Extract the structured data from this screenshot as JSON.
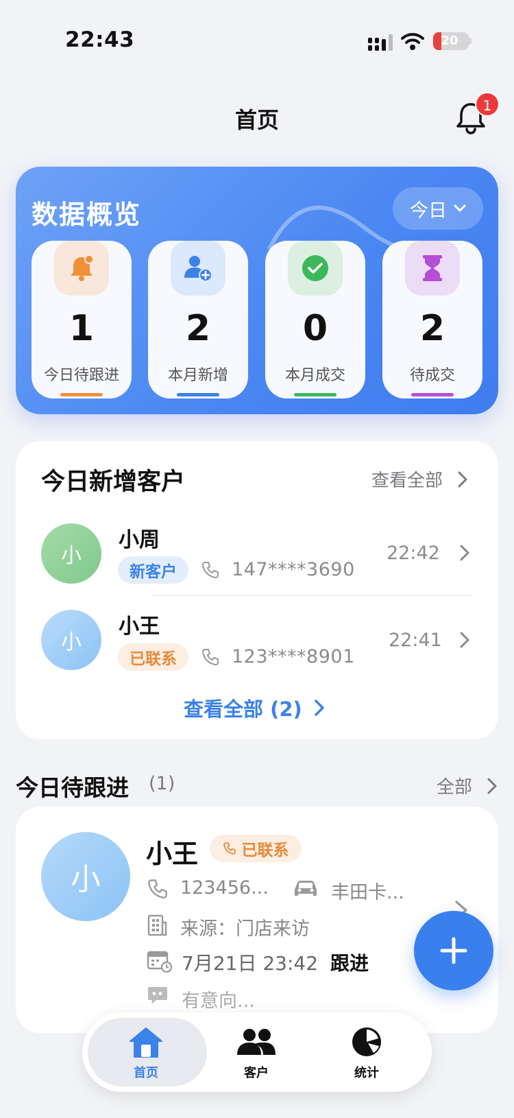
{
  "status_bar": {
    "time": "22:43",
    "battery": "20"
  },
  "header": {
    "title": "首页",
    "notification_count": "1"
  },
  "overview": {
    "title": "数据概览",
    "range": "今日",
    "stats": [
      {
        "value": "1",
        "label": "今日待跟进",
        "icon": "bell-icon",
        "color": "#f0913a"
      },
      {
        "value": "2",
        "label": "本月新增",
        "icon": "add-user-icon",
        "color": "#3b82e9"
      },
      {
        "value": "0",
        "label": "本月成交",
        "icon": "check-circle-icon",
        "color": "#3cb85a"
      },
      {
        "value": "2",
        "label": "待成交",
        "icon": "hourglass-icon",
        "color": "#b44fd6"
      }
    ]
  },
  "new_customers": {
    "title": "今日新增客户",
    "see_all": "查看全部",
    "items": [
      {
        "avatar": "小",
        "name": "小周",
        "tag": "新客户",
        "phone": "147****3690",
        "time": "22:42"
      },
      {
        "avatar": "小",
        "name": "小王",
        "tag": "已联系",
        "phone": "123****8901",
        "time": "22:41"
      }
    ],
    "view_all": "查看全部 (2)"
  },
  "follow_up": {
    "title": "今日待跟进",
    "count": "(1)",
    "all": "全部",
    "item": {
      "avatar": "小",
      "name": "小王",
      "tag": "已联系",
      "phone": "123456...",
      "car": "丰田卡...",
      "source": "来源：门店来访",
      "date": "7月21日 23:42",
      "action": "跟进",
      "note": "有意向..."
    }
  },
  "tabs": [
    {
      "label": "首页",
      "icon": "home-icon",
      "active": true
    },
    {
      "label": "客户",
      "icon": "users-icon",
      "active": false
    },
    {
      "label": "统计",
      "icon": "pie-chart-icon",
      "active": false
    }
  ],
  "colors": {
    "primary": "#3b82e9",
    "orange": "#f0913a",
    "green": "#3cb85a",
    "purple": "#b44fd6"
  }
}
